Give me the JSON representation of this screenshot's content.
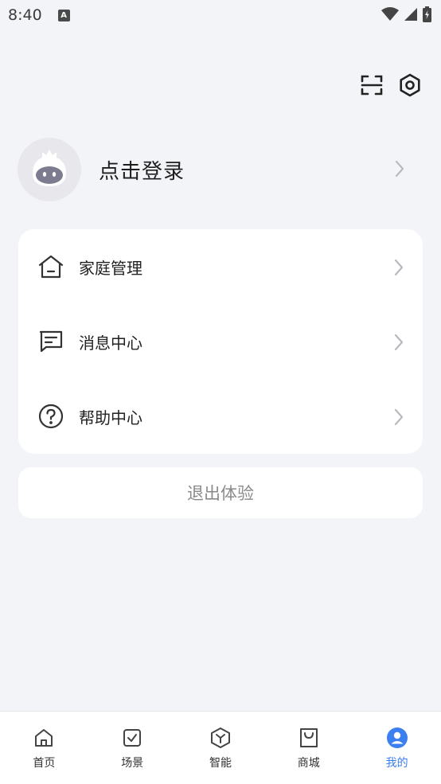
{
  "status_bar": {
    "time": "8:40",
    "app_icon": "A"
  },
  "top_actions": [
    {
      "name": "scan-icon"
    },
    {
      "name": "settings-icon"
    }
  ],
  "profile": {
    "login_label": "点击登录"
  },
  "menu": [
    {
      "label": "家庭管理",
      "icon": "home-icon"
    },
    {
      "label": "消息中心",
      "icon": "message-icon"
    },
    {
      "label": "帮助中心",
      "icon": "help-icon"
    }
  ],
  "logout_label": "退出体验",
  "bottom_nav": [
    {
      "label": "首页",
      "icon": "home-icon",
      "active": false
    },
    {
      "label": "场景",
      "icon": "scene-icon",
      "active": false
    },
    {
      "label": "智能",
      "icon": "smart-icon",
      "active": false
    },
    {
      "label": "商城",
      "icon": "shop-icon",
      "active": false
    },
    {
      "label": "我的",
      "icon": "profile-icon",
      "active": true
    }
  ],
  "colors": {
    "accent": "#3b7ff0",
    "background": "#f3f4f8",
    "card": "#ffffff"
  }
}
